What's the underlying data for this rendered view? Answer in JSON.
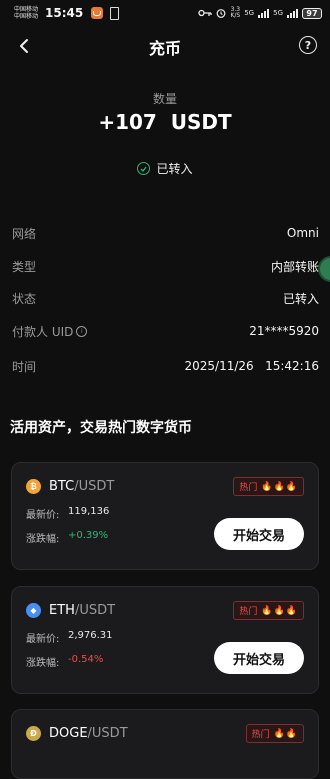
{
  "status_bar": {
    "carrier_1": "中国移动",
    "carrier_2": "中国移动",
    "time": "15:45",
    "speed_top": "3.3",
    "speed_bottom": "K/S",
    "net_1": "5G",
    "net_2": "5G",
    "battery": "97"
  },
  "header": {
    "title": "充币",
    "help": "?"
  },
  "amount": {
    "label": "数量",
    "value": "+107  USDT",
    "status": "已转入"
  },
  "details": {
    "network_label": "网络",
    "network_value": "Omni",
    "type_label": "类型",
    "type_value": "内部转账",
    "state_label": "状态",
    "state_value": "已转入",
    "payer_label": "付款人 UID",
    "payer_value": "21****5920",
    "time_label": "时间",
    "time_value": "2025/11/26   15:42:16"
  },
  "section": {
    "title": "活用资产，交易热门数字货币"
  },
  "markets": [
    {
      "base": "BTC",
      "quote": "/USDT",
      "icon": "bitcoin-icon",
      "color": "#f2a33a",
      "badge": "热门",
      "price_label": "最新价:",
      "price": "119,136",
      "change_label": "涨跌幅:",
      "change": "+0.39%",
      "trade": "开始交易"
    },
    {
      "base": "ETH",
      "quote": "/USDT",
      "icon": "ethereum-icon",
      "color": "#4a8ff0",
      "badge": "热门",
      "price_label": "最新价:",
      "price": "2,976.31",
      "change_label": "涨跌幅:",
      "change": "-0.54%",
      "trade": "开始交易"
    },
    {
      "base": "DOGE",
      "quote": "/USDT",
      "icon": "dogecoin-icon",
      "color": "#c9a94a",
      "badge": "热门"
    }
  ],
  "colors": {
    "background": "#0f0f10",
    "card": "#1b1b1d",
    "up": "#2bb673",
    "down": "#e2514c"
  }
}
